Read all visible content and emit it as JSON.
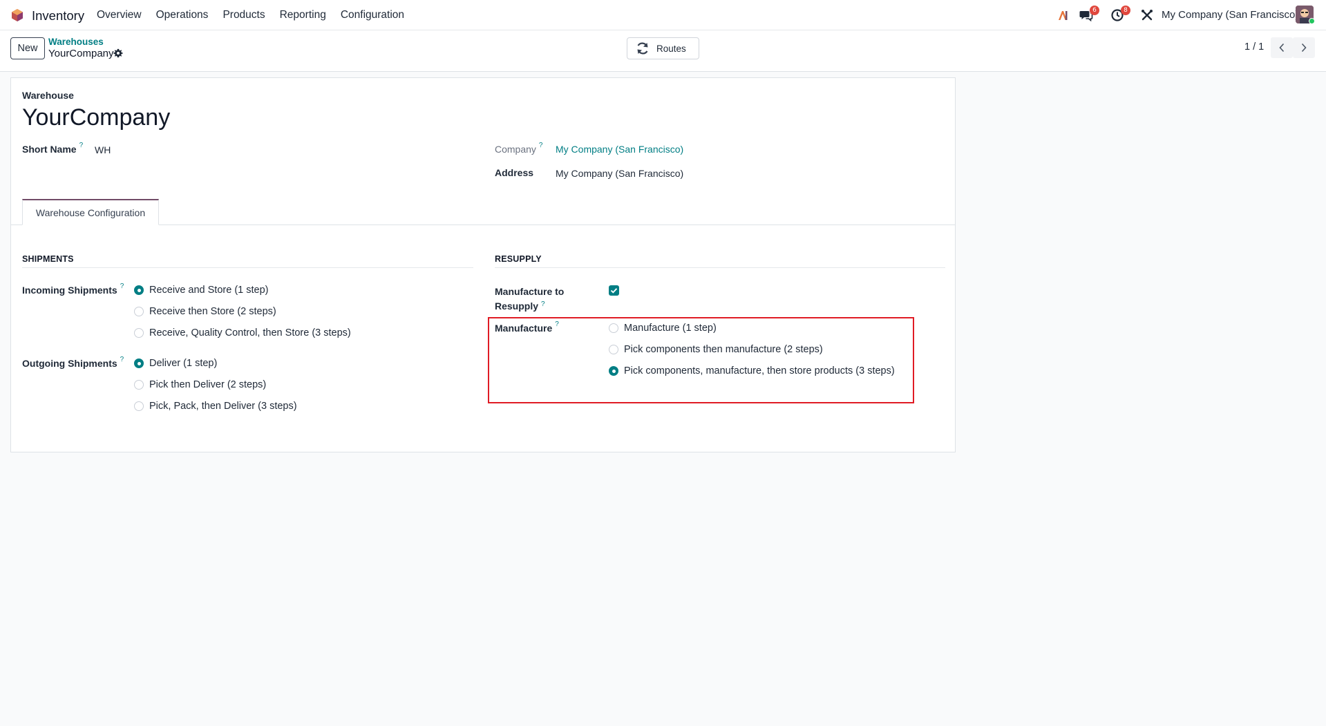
{
  "navbar": {
    "app_name": "Inventory",
    "menu": [
      "Overview",
      "Operations",
      "Products",
      "Reporting",
      "Configuration"
    ],
    "messages_badge": "6",
    "activities_badge": "8",
    "company": "My Company (San Francisco)"
  },
  "control_panel": {
    "new_label": "New",
    "breadcrumb_parent": "Warehouses",
    "breadcrumb_current": "YourCompany",
    "routes_label": "Routes",
    "pager": "1 / 1"
  },
  "form": {
    "title_label": "Warehouse",
    "name": "YourCompany",
    "short_name_label": "Short Name",
    "short_name": "WH",
    "company_label": "Company",
    "company": "My Company (San Francisco)",
    "address_label": "Address",
    "address": "My Company (San Francisco)",
    "help_mark": "?",
    "tab_label": "Warehouse Configuration"
  },
  "shipments": {
    "title": "SHIPMENTS",
    "incoming_label": "Incoming Shipments",
    "incoming_options": [
      "Receive and Store (1 step)",
      "Receive then Store (2 steps)",
      "Receive, Quality Control, then Store (3 steps)"
    ],
    "incoming_selected": 0,
    "outgoing_label": "Outgoing Shipments",
    "outgoing_options": [
      "Deliver (1 step)",
      "Pick then Deliver (2 steps)",
      "Pick, Pack, then Deliver (3 steps)"
    ],
    "outgoing_selected": 0
  },
  "resupply": {
    "title": "RESUPPLY",
    "manufacture_to_resupply_label_line1": "Manufacture to",
    "manufacture_to_resupply_label_line2": "Resupply",
    "manufacture_to_resupply_checked": true,
    "manufacture_label": "Manufacture",
    "manufacture_options": [
      "Manufacture (1 step)",
      "Pick components then manufacture (2 steps)",
      "Pick components, manufacture, then store products (3 steps)"
    ],
    "manufacture_selected": 2
  },
  "colors": {
    "accent": "#017e84",
    "brand": "#714b67",
    "highlight": "#e01b24"
  }
}
